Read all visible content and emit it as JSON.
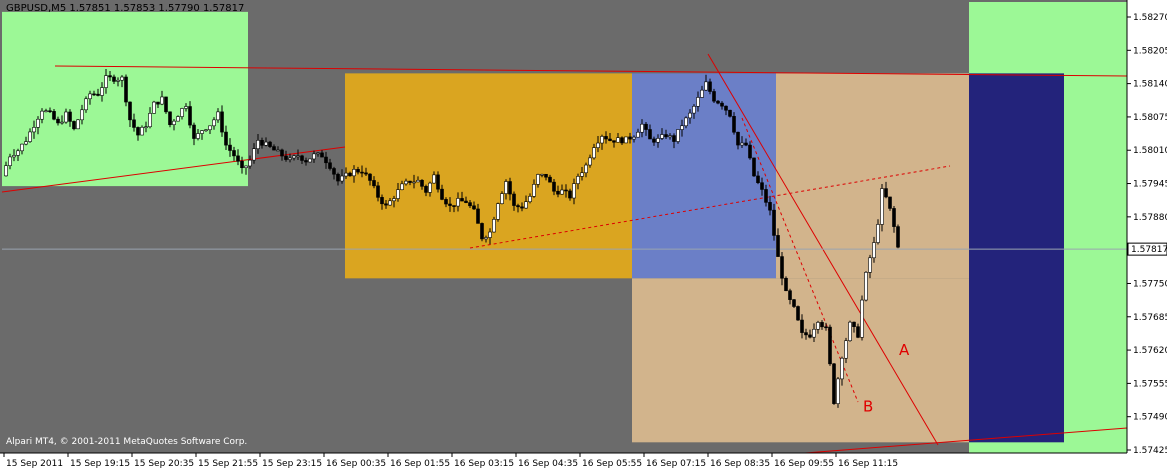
{
  "window": {
    "title": "GBPUSD,M5  1.57851 1.57853 1.57790 1.57817",
    "copyright": "Alpari MT4, © 2001-2011 MetaQuotes Software Corp."
  },
  "colors": {
    "background": "#6b6b6b",
    "zone_green": "#9cf896",
    "zone_orange": "#daa520",
    "zone_blue": "#6b7fc7",
    "zone_tan": "#d2b48c",
    "zone_navy": "#23237b",
    "candle": "#000000",
    "lines": "#dd0000",
    "current_price_line": "#9aa4b0"
  },
  "chart_data": {
    "type": "candlestick",
    "symbol": "GBPUSD",
    "timeframe": "M5",
    "ohlc_current": {
      "open": 1.57851,
      "high": 1.57853,
      "low": 1.5779,
      "close": 1.57817
    },
    "current_price": 1.57817,
    "current_price_label": "1.57817",
    "ylim": [
      1.5738,
      1.5793
    ],
    "y_ticks": [
      "1.58270",
      "1.58205",
      "1.58140",
      "1.58075",
      "1.58010",
      "1.57945",
      "1.57880",
      "1.57815",
      "1.57750",
      "1.57685",
      "1.57620",
      "1.57555",
      "1.57490",
      "1.57425"
    ],
    "y_tick_values": [
      1.5827,
      1.58205,
      1.5814,
      1.58075,
      1.5801,
      1.57945,
      1.5788,
      1.57815,
      1.5775,
      1.57685,
      1.5762,
      1.57555,
      1.5749,
      1.57425
    ],
    "x_ticks": [
      "15 Sep 2011",
      "15 Sep 19:15",
      "15 Sep 20:35",
      "15 Sep 21:55",
      "15 Sep 23:15",
      "16 Sep 00:35",
      "16 Sep 01:55",
      "16 Sep 03:15",
      "16 Sep 04:35",
      "16 Sep 05:55",
      "16 Sep 07:15",
      "16 Sep 08:35",
      "16 Sep 09:55",
      "16 Sep 11:15"
    ],
    "close_path": [
      [
        0,
        1.5796
      ],
      [
        8,
        1.58
      ],
      [
        16,
        1.5801
      ],
      [
        24,
        1.5803
      ],
      [
        32,
        1.5806
      ],
      [
        40,
        1.5809
      ],
      [
        48,
        1.5808
      ],
      [
        56,
        1.5806
      ],
      [
        64,
        1.5808
      ],
      [
        72,
        1.5805
      ],
      [
        80,
        1.5809
      ],
      [
        88,
        1.5812
      ],
      [
        96,
        1.5812
      ],
      [
        104,
        1.5815
      ],
      [
        112,
        1.5815
      ],
      [
        120,
        1.5815
      ],
      [
        128,
        1.5807
      ],
      [
        136,
        1.5804
      ],
      [
        144,
        1.5806
      ],
      [
        152,
        1.581
      ],
      [
        160,
        1.5811
      ],
      [
        168,
        1.5806
      ],
      [
        176,
        1.5808
      ],
      [
        184,
        1.581
      ],
      [
        192,
        1.5803
      ],
      [
        200,
        1.5805
      ],
      [
        208,
        1.5806
      ],
      [
        216,
        1.5808
      ],
      [
        224,
        1.5802
      ],
      [
        232,
        1.58
      ],
      [
        240,
        1.5797
      ],
      [
        248,
        1.5799
      ],
      [
        256,
        1.5803
      ],
      [
        264,
        1.5802
      ],
      [
        272,
        1.5801
      ],
      [
        280,
        1.58
      ],
      [
        288,
        1.5799
      ],
      [
        296,
        1.58
      ],
      [
        304,
        1.5799
      ],
      [
        312,
        1.58
      ],
      [
        320,
        1.58
      ],
      [
        328,
        1.5798
      ],
      [
        336,
        1.5795
      ],
      [
        344,
        1.5796
      ],
      [
        352,
        1.5797
      ],
      [
        360,
        1.5797
      ],
      [
        368,
        1.5795
      ],
      [
        376,
        1.5792
      ],
      [
        384,
        1.579
      ],
      [
        392,
        1.5792
      ],
      [
        400,
        1.5794
      ],
      [
        408,
        1.5795
      ],
      [
        416,
        1.5795
      ],
      [
        424,
        1.5793
      ],
      [
        432,
        1.5796
      ],
      [
        440,
        1.5792
      ],
      [
        448,
        1.579
      ],
      [
        456,
        1.5791
      ],
      [
        464,
        1.5791
      ],
      [
        472,
        1.5789
      ],
      [
        480,
        1.5784
      ],
      [
        488,
        1.5785
      ],
      [
        496,
        1.5791
      ],
      [
        504,
        1.5795
      ],
      [
        512,
        1.579
      ],
      [
        520,
        1.579
      ],
      [
        528,
        1.5792
      ],
      [
        536,
        1.5796
      ],
      [
        544,
        1.5796
      ],
      [
        552,
        1.5793
      ],
      [
        560,
        1.5793
      ],
      [
        568,
        1.5792
      ],
      [
        576,
        1.5796
      ],
      [
        584,
        1.5798
      ],
      [
        592,
        1.5802
      ],
      [
        600,
        1.5804
      ],
      [
        608,
        1.5803
      ],
      [
        616,
        1.5803
      ],
      [
        624,
        1.5803
      ],
      [
        632,
        1.5804
      ],
      [
        640,
        1.5806
      ],
      [
        648,
        1.5803
      ],
      [
        656,
        1.5803
      ],
      [
        664,
        1.5804
      ],
      [
        672,
        1.5803
      ],
      [
        680,
        1.5806
      ],
      [
        688,
        1.5808
      ],
      [
        696,
        1.5811
      ],
      [
        704,
        1.5814
      ],
      [
        712,
        1.5811
      ],
      [
        720,
        1.581
      ],
      [
        728,
        1.5808
      ],
      [
        736,
        1.5802
      ],
      [
        744,
        1.5802
      ],
      [
        752,
        1.5796
      ],
      [
        760,
        1.5793
      ],
      [
        768,
        1.5789
      ],
      [
        776,
        1.578
      ],
      [
        784,
        1.5773
      ],
      [
        792,
        1.577
      ],
      [
        800,
        1.5765
      ],
      [
        808,
        1.5765
      ],
      [
        816,
        1.5768
      ],
      [
        824,
        1.5766
      ],
      [
        832,
        1.5752
      ],
      [
        840,
        1.5761
      ],
      [
        848,
        1.5767
      ],
      [
        856,
        1.5765
      ],
      [
        862,
        1.5775
      ],
      [
        868,
        1.578
      ],
      [
        874,
        1.5784
      ],
      [
        880,
        1.5793
      ],
      [
        886,
        1.5791
      ],
      [
        892,
        1.5786
      ],
      [
        896,
        1.5782
      ]
    ],
    "zones": [
      {
        "name": "green-left",
        "x0": 0,
        "x1": 246,
        "y0": 1.5828,
        "y1": 1.5794
      },
      {
        "name": "orange",
        "x0": 343,
        "x1": 630,
        "y0": 1.5816,
        "y1": 1.5776
      },
      {
        "name": "blue",
        "x0": 630,
        "x1": 774,
        "y0": 1.5816,
        "y1": 1.5776
      },
      {
        "name": "tan",
        "x0": 630,
        "x1": 967,
        "y0": 1.5776,
        "y1": 1.5744
      },
      {
        "name": "tan-upper",
        "x0": 774,
        "x1": 967,
        "y0": 1.5816,
        "y1": 1.5776
      },
      {
        "name": "green-right",
        "x0": 967,
        "x1": 1127,
        "y0": 1.5833,
        "y1": 1.5738
      },
      {
        "name": "navy",
        "x0": 967,
        "x1": 1062,
        "y0": 1.5816,
        "y1": 1.5744
      }
    ],
    "annotations": [
      {
        "text": "A",
        "x": 897,
        "y": 1.5761
      },
      {
        "text": "B",
        "x": 861,
        "y": 1.575
      }
    ]
  }
}
